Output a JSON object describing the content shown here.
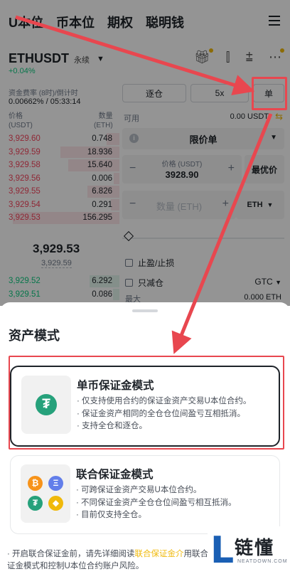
{
  "header": {
    "tabs": [
      "U本位",
      "币本位",
      "期权",
      "聪明钱"
    ]
  },
  "ticker": {
    "pair": "ETHUSDT",
    "contract_type": "永续",
    "change": "+0.04%",
    "funding_label": "资金费率 (8时)/倒计时",
    "funding_value": "0.00662% / 05:33:14"
  },
  "orderbook": {
    "price_header": "价格\n(USDT)",
    "qty_header": "数量\n(ETH)",
    "asks": [
      {
        "price": "3,929.60",
        "qty": "0.748",
        "depth": 0.12
      },
      {
        "price": "3,929.59",
        "qty": "18.936",
        "depth": 0.55
      },
      {
        "price": "3,929.58",
        "qty": "15.640",
        "depth": 0.48
      },
      {
        "price": "3,929.56",
        "qty": "0.006",
        "depth": 0.05
      },
      {
        "price": "3,929.55",
        "qty": "6.826",
        "depth": 0.3
      },
      {
        "price": "3,929.54",
        "qty": "0.291",
        "depth": 0.08
      },
      {
        "price": "3,929.53",
        "qty": "156.295",
        "depth": 1.0
      }
    ],
    "last_price": "3,929.53",
    "mark_price": "3,929.59",
    "bids": [
      {
        "price": "3,929.52",
        "qty": "6.292",
        "depth": 0.28
      },
      {
        "price": "3,929.51",
        "qty": "0.086",
        "depth": 0.06
      }
    ]
  },
  "order_form": {
    "margin_mode": "逐仓",
    "leverage": "5x",
    "asset_mode_short": "单",
    "available_label": "可用",
    "available_value": "0.00 USDT",
    "order_type": "限价单",
    "price_label": "价格 (USDT)",
    "price_value": "3928.90",
    "best_price_label": "最优价",
    "quantity_placeholder": "数量 (ETH)",
    "quantity_unit": "ETH",
    "tp_sl_label": "止盈/止损",
    "reduce_only_label": "只减仓",
    "time_in_force": "GTC",
    "max_label": "最大",
    "max_value": "0.000 ETH"
  },
  "sheet": {
    "title": "资产模式",
    "options": [
      {
        "title": "单币保证金模式",
        "icon": "tether-icon",
        "lines": [
          "· 仅支持使用合约的保证金资产交易U本位合约。",
          "· 保证金资产相同的全仓仓位间盈亏互相抵消。",
          "· 支持全仓和逐仓。"
        ],
        "selected": true
      },
      {
        "title": "联合保证金模式",
        "icons": [
          "bitcoin-icon",
          "ethereum-icon",
          "tether-icon",
          "bnb-icon"
        ],
        "lines": [
          "· 可跨保证金资产交易U本位合约。",
          "· 不同保证金资产全仓仓位间盈亏相互抵消。",
          "· 目前仅支持全仓。"
        ],
        "selected": false
      }
    ],
    "footer_prefix": "· 开启联合保证金前，请先详细阅读",
    "footer_link": "联合保证金介",
    "footer_suffix": "用联合保证金模式和控制U本位合约账户风险。"
  },
  "watermark": {
    "logo_letter": "L",
    "name": "链懂",
    "domain": "NEATDOWN.COM"
  },
  "colors": {
    "annotation_red": "#e8474f",
    "tether_green": "#26a17b",
    "binance_yellow": "#f0b90b",
    "ask_red": "#f6465d",
    "bid_green": "#0ecb81"
  }
}
